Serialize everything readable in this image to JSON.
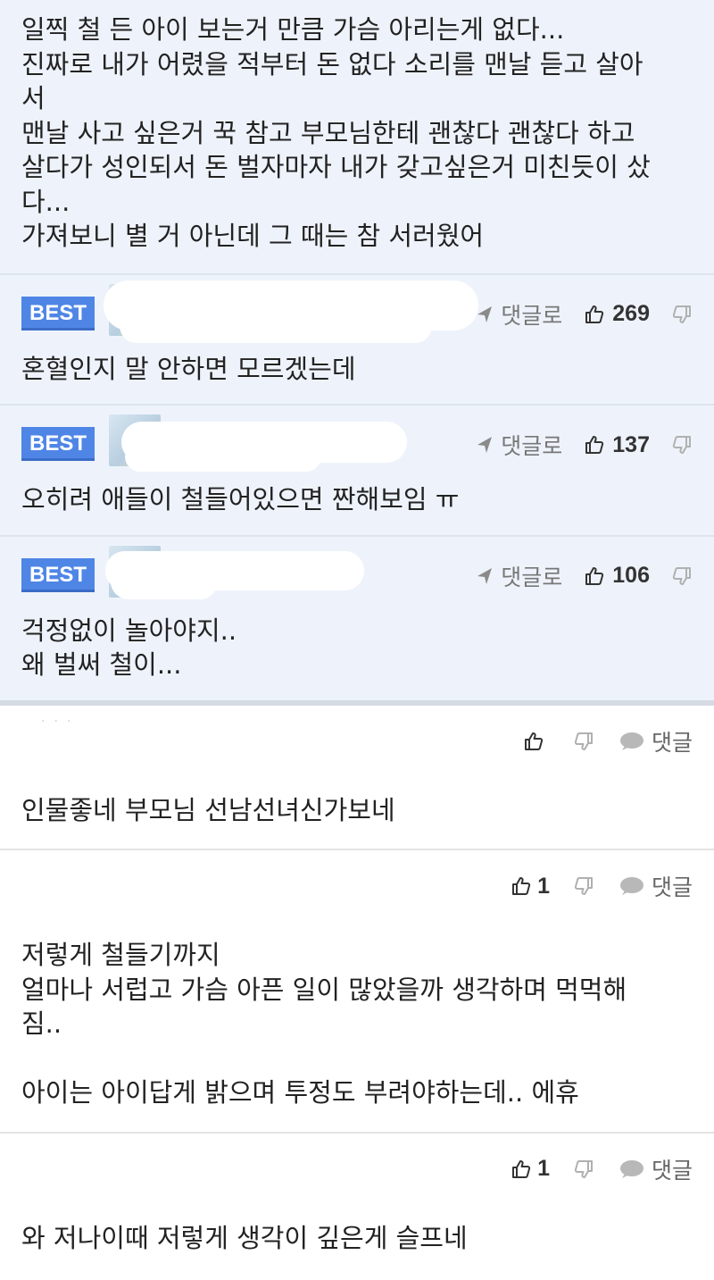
{
  "top_comment": {
    "text": "일찍 철 든 아이 보는거 만큼 가슴 아리는게 없다...\n진짜로 내가 어렸을 적부터 돈 없다 소리를 맨날 듣고 살아\n서\n맨날 사고 싶은거 꾹 참고 부모님한테 괜찮다 괜찮다 하고\n살다가 성인되서 돈 벌자마자 내가 갖고싶은거 미친듯이 샀\n다...\n가져보니 별 거 아닌데 그 때는 참 서러웠어"
  },
  "best_comments": [
    {
      "badge": "BEST",
      "reply_label": "댓글로",
      "likes": "269",
      "text": "혼혈인지 말 안하면 모르겠는데"
    },
    {
      "badge": "BEST",
      "reply_label": "댓글로",
      "likes": "137",
      "text": "오히려 애들이 철들어있으면 짠해보임 ㅠ"
    },
    {
      "badge": "BEST",
      "reply_label": "댓글로",
      "likes": "106",
      "text": "걱정없이 놀아야지..\n왜 벌써 철이..."
    }
  ],
  "comments": [
    {
      "likes": "",
      "reply_label": "댓글",
      "text": "인물좋네 부모님 선남선녀신가보네"
    },
    {
      "likes": "1",
      "reply_label": "댓글",
      "text": "저렇게 철들기까지\n얼마나 서럽고 가슴 아픈 일이 많았을까 생각하며 먹먹해\n짐..\n\n아이는 아이답게 밝으며 투정도 부려야하는데.. 에휴"
    },
    {
      "likes": "1",
      "reply_label": "댓글",
      "text": "와 저나이때 저렇게 생각이 깊은게 슬프네"
    }
  ],
  "icons": {
    "like": "thumbs-up-icon",
    "dislike": "thumbs-down-icon",
    "reply": "reply-arrow-icon",
    "chat": "speech-bubble-icon"
  },
  "colors": {
    "best_badge": "#4f86e6",
    "best_background": "#eef3fb"
  }
}
